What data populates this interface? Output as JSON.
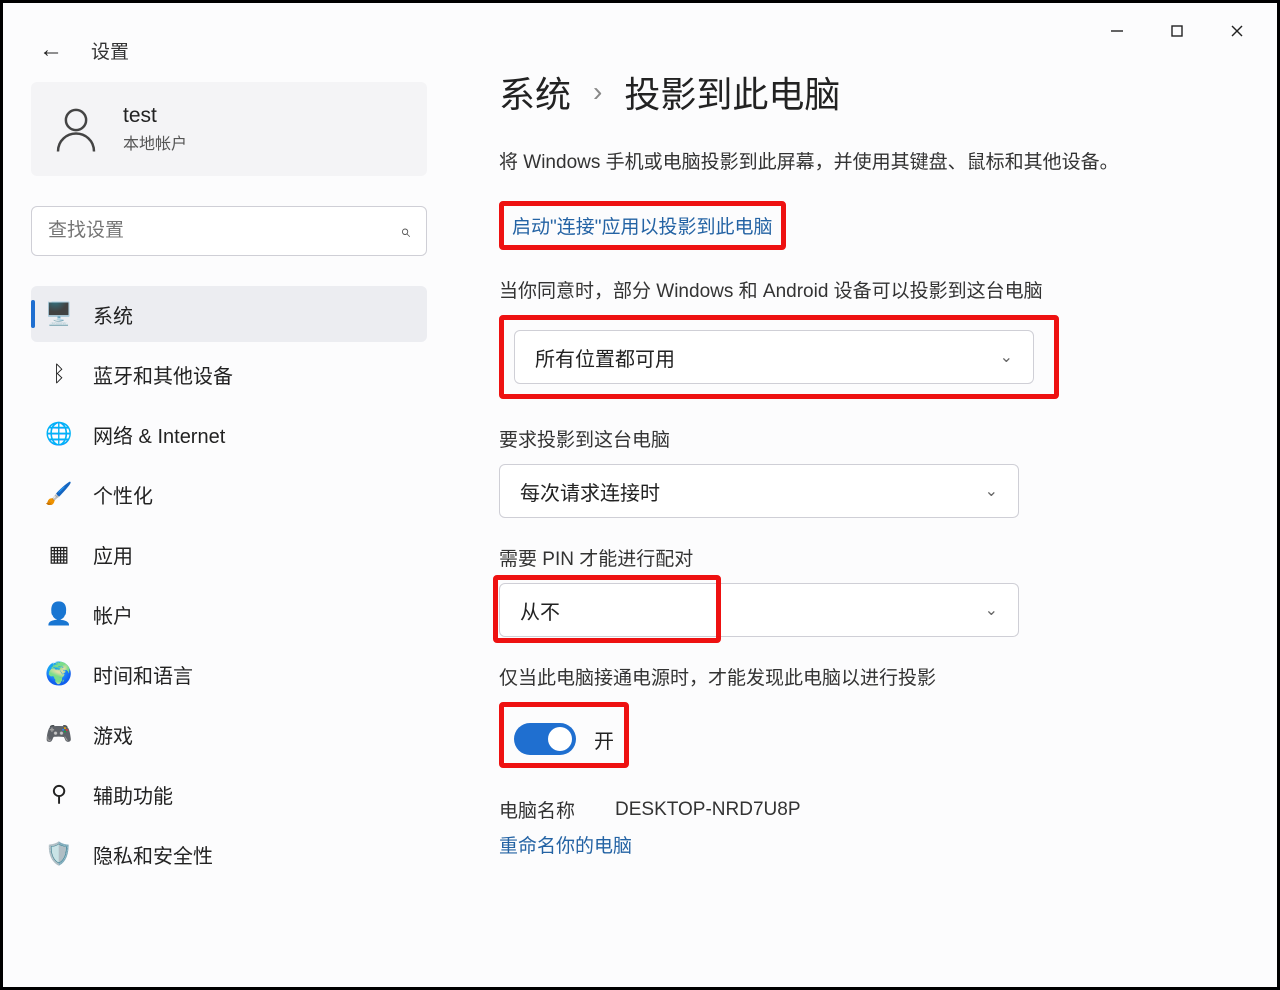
{
  "window": {
    "title": "设置"
  },
  "account": {
    "name": "test",
    "type": "本地帐户"
  },
  "search": {
    "placeholder": "查找设置"
  },
  "nav": [
    {
      "key": "system",
      "label": "系统",
      "icon": "🖥️",
      "iconName": "system-icon",
      "selected": true
    },
    {
      "key": "bluetooth",
      "label": "蓝牙和其他设备",
      "icon": "ᛒ",
      "iconName": "bluetooth-icon",
      "selected": false
    },
    {
      "key": "network",
      "label": "网络 & Internet",
      "icon": "🌐",
      "iconName": "wifi-icon",
      "selected": false
    },
    {
      "key": "personalization",
      "label": "个性化",
      "icon": "🖌️",
      "iconName": "brush-icon",
      "selected": false
    },
    {
      "key": "apps",
      "label": "应用",
      "icon": "▦",
      "iconName": "apps-icon",
      "selected": false
    },
    {
      "key": "accounts",
      "label": "帐户",
      "icon": "👤",
      "iconName": "person-icon",
      "selected": false
    },
    {
      "key": "timelang",
      "label": "时间和语言",
      "icon": "🌍",
      "iconName": "globe-icon",
      "selected": false
    },
    {
      "key": "gaming",
      "label": "游戏",
      "icon": "🎮",
      "iconName": "gamepad-icon",
      "selected": false
    },
    {
      "key": "accessibility",
      "label": "辅助功能",
      "icon": "⚲",
      "iconName": "accessibility-icon",
      "selected": false
    },
    {
      "key": "privacy",
      "label": "隐私和安全性",
      "icon": "🛡️",
      "iconName": "shield-icon",
      "selected": false
    }
  ],
  "breadcrumb": {
    "root": "系统",
    "sep": "›",
    "page": "投影到此电脑"
  },
  "page": {
    "description": "将 Windows 手机或电脑投影到此屏幕，并使用其键盘、鼠标和其他设备。",
    "launch_link": "启动\"连接\"应用以投影到此电脑",
    "consent_label": "当你同意时，部分 Windows 和 Android 设备可以投影到这台电脑",
    "consent_value": "所有位置都可用",
    "ask_label": "要求投影到这台电脑",
    "ask_value": "每次请求连接时",
    "pin_label": "需要 PIN 才能进行配对",
    "pin_value": "从不",
    "power_label": "仅当此电脑接通电源时，才能发现此电脑以进行投影",
    "toggle_state": "开",
    "pcname_label": "电脑名称",
    "pcname_value": "DESKTOP-NRD7U8P",
    "rename_link": "重命名你的电脑"
  },
  "icons": {
    "search": "⌕",
    "chevron": "⌄"
  },
  "colors": {
    "accent": "#1f6fd0",
    "highlight": "#e11"
  }
}
